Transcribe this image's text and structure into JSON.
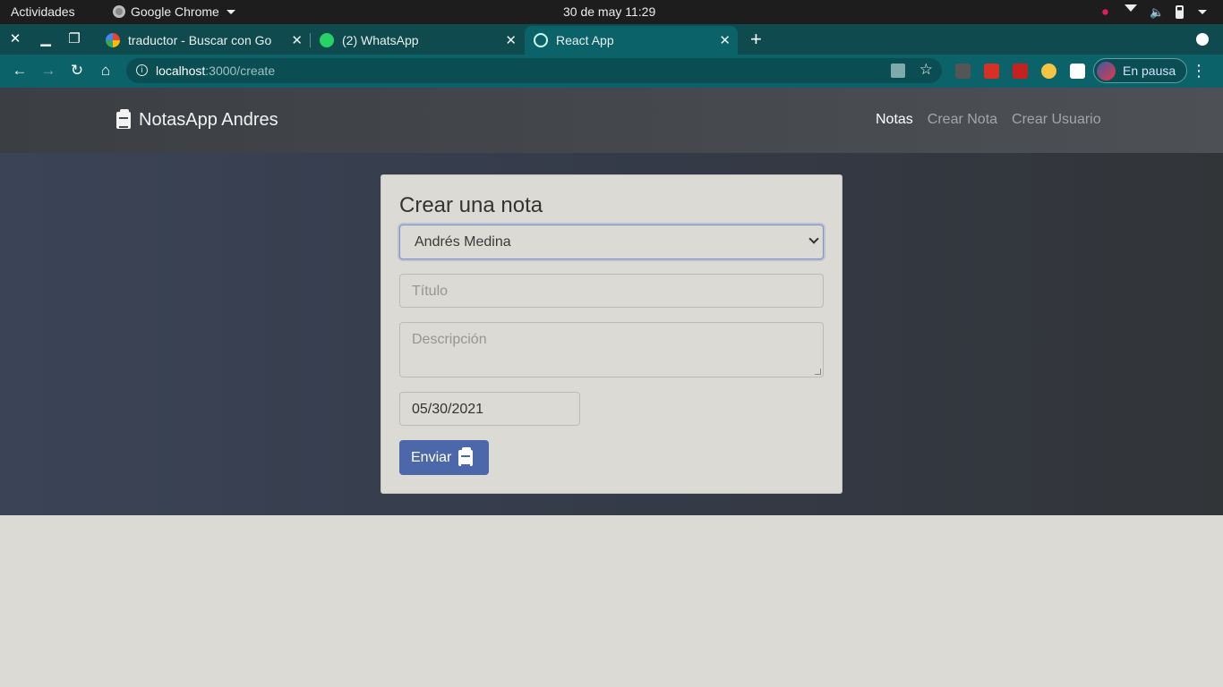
{
  "os_bar": {
    "activities": "Actividades",
    "app_name": "Google Chrome",
    "clock": "30 de may  11:29"
  },
  "browser": {
    "tabs": [
      {
        "title": "traductor - Buscar con Go",
        "favicon": "google-icon",
        "active": false
      },
      {
        "title": "(2) WhatsApp",
        "favicon": "whatsapp-icon",
        "active": false
      },
      {
        "title": "React App",
        "favicon": "react-icon",
        "active": true
      }
    ],
    "url_host": "localhost",
    "url_path": ":3000/create",
    "profile_label": "En pausa"
  },
  "app": {
    "brand": "NotasApp Andres",
    "nav": [
      {
        "label": "Notas",
        "active": true
      },
      {
        "label": "Crear Nota",
        "active": false
      },
      {
        "label": "Crear Usuario",
        "active": false
      }
    ]
  },
  "form": {
    "heading": "Crear una nota",
    "user_select_value": "Andrés Medina",
    "title_placeholder": "Título",
    "description_placeholder": "Descripción",
    "date_value": "05/30/2021",
    "submit_label": "Enviar"
  },
  "colors": {
    "tab_strip": "#0f4a4f",
    "toolbar": "#0b6268",
    "navbar": "#454a4e",
    "submit": "#4c68aa"
  }
}
